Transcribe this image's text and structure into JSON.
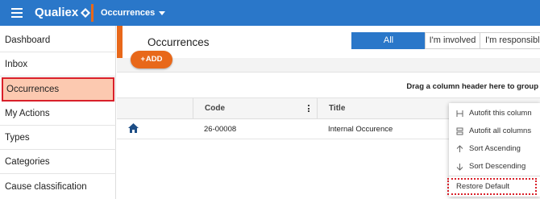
{
  "topbar": {
    "brand": "Qualiex",
    "module": "Occurrences",
    "colors": {
      "bar": "#2a77c9",
      "accent": "#e8681a"
    }
  },
  "sidebar": {
    "items": [
      {
        "label": "Dashboard"
      },
      {
        "label": "Inbox"
      },
      {
        "label": "Occurrences",
        "active": true
      },
      {
        "label": "My Actions"
      },
      {
        "label": "Types"
      },
      {
        "label": "Categories"
      },
      {
        "label": "Cause classification"
      }
    ]
  },
  "main": {
    "title": "Occurrences",
    "filters": [
      {
        "label": "All",
        "selected": true
      },
      {
        "label": "I'm involved"
      },
      {
        "label": "I'm responsible"
      }
    ],
    "add_label": "ADD",
    "group_hint": "Drag a column header here to group",
    "columns": [
      "Code",
      "Title"
    ],
    "rows": [
      {
        "icon": "home-icon",
        "code": "26-00008",
        "title": "Internal Occurence"
      }
    ]
  },
  "column_menu": {
    "items": [
      {
        "label": "Autofit this column",
        "icon": "autofit-column-icon"
      },
      {
        "label": "Autofit all columns",
        "icon": "autofit-all-icon"
      },
      {
        "label": "Sort Ascending",
        "icon": "arrow-up-icon"
      },
      {
        "label": "Sort Descending",
        "icon": "arrow-down-icon"
      }
    ],
    "restore_label": "Restore Default"
  }
}
